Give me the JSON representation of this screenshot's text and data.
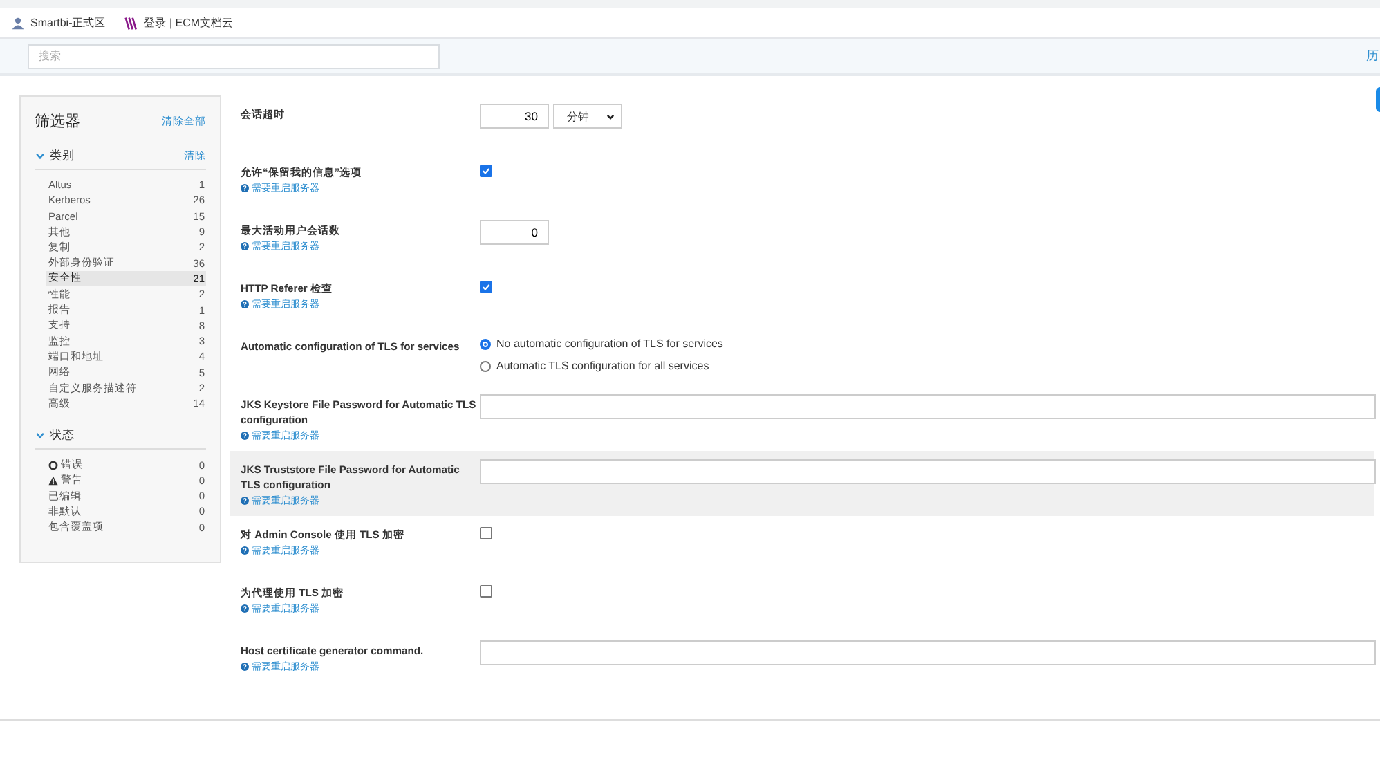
{
  "bookmarks": [
    {
      "label": "Smartbi-正式区",
      "kind": "person"
    },
    {
      "label": "登录 | ECM文档云",
      "kind": "logo"
    }
  ],
  "search": {
    "placeholder": "搜索"
  },
  "history_link": "历",
  "filters": {
    "title": "筛选器",
    "clear_all": "清除全部",
    "groups": [
      {
        "title": "类别",
        "clear": "清除",
        "expanded": true,
        "items": [
          {
            "label": "Altus",
            "count": "1",
            "selected": false
          },
          {
            "label": "Kerberos",
            "count": "26",
            "selected": false
          },
          {
            "label": "Parcel",
            "count": "15",
            "selected": false
          },
          {
            "label": "其他",
            "count": "9",
            "selected": false
          },
          {
            "label": "复制",
            "count": "2",
            "selected": false
          },
          {
            "label": "外部身份验证",
            "count": "36",
            "selected": false
          },
          {
            "label": "安全性",
            "count": "21",
            "selected": true
          },
          {
            "label": "性能",
            "count": "2",
            "selected": false
          },
          {
            "label": "报告",
            "count": "1",
            "selected": false
          },
          {
            "label": "支持",
            "count": "8",
            "selected": false
          },
          {
            "label": "监控",
            "count": "3",
            "selected": false
          },
          {
            "label": "端口和地址",
            "count": "4",
            "selected": false
          },
          {
            "label": "网络",
            "count": "5",
            "selected": false
          },
          {
            "label": "自定义服务描述符",
            "count": "2",
            "selected": false
          },
          {
            "label": "高级",
            "count": "14",
            "selected": false
          }
        ]
      },
      {
        "title": "状态",
        "expanded": true,
        "items": [
          {
            "label": "错误",
            "count": "0",
            "selected": false,
            "kind": "error"
          },
          {
            "label": "警告",
            "count": "0",
            "selected": false,
            "kind": "warning"
          },
          {
            "label": "已编辑",
            "count": "0",
            "selected": false
          },
          {
            "label": "非默认",
            "count": "0",
            "selected": false
          },
          {
            "label": "包含覆盖项",
            "count": "0",
            "selected": false
          }
        ]
      }
    ]
  },
  "settings": [
    {
      "kind": "number_select",
      "label": "会话超时",
      "value": "30",
      "unit": "分钟",
      "highlighted": false
    },
    {
      "kind": "checkbox",
      "label": "允许“保留我的信息”选项",
      "note": "需要重启服务器",
      "checked": true,
      "highlighted": false
    },
    {
      "kind": "number",
      "label": "最大活动用户会话数",
      "note": "需要重启服务器",
      "value": "0",
      "highlighted": false
    },
    {
      "kind": "checkbox",
      "label": "HTTP Referer 检查",
      "note": "需要重启服务器",
      "checked": true,
      "highlighted": false
    },
    {
      "kind": "radio",
      "label": "Automatic configuration of TLS for services",
      "highlighted": false,
      "options": [
        {
          "label": "No automatic configuration of TLS for services",
          "selected": true
        },
        {
          "label": "Automatic TLS configuration for all services",
          "selected": false
        }
      ]
    },
    {
      "kind": "text",
      "label": "JKS Keystore File Password for Automatic TLS configuration",
      "note": "需要重启服务器",
      "highlighted": false
    },
    {
      "kind": "text",
      "label": "JKS Truststore File Password for Automatic TLS configuration",
      "note": "需要重启服务器",
      "highlighted": true
    },
    {
      "kind": "checkbox",
      "label": "对 Admin Console 使用 TLS 加密",
      "note": "需要重启服务器",
      "checked": false,
      "highlighted": false
    },
    {
      "kind": "checkbox",
      "label": "为代理使用 TLS 加密",
      "note": "需要重启服务器",
      "checked": false,
      "highlighted": false
    },
    {
      "kind": "text",
      "label": "Host certificate generator command.",
      "note": "需要重启服务器",
      "highlighted": false
    }
  ]
}
